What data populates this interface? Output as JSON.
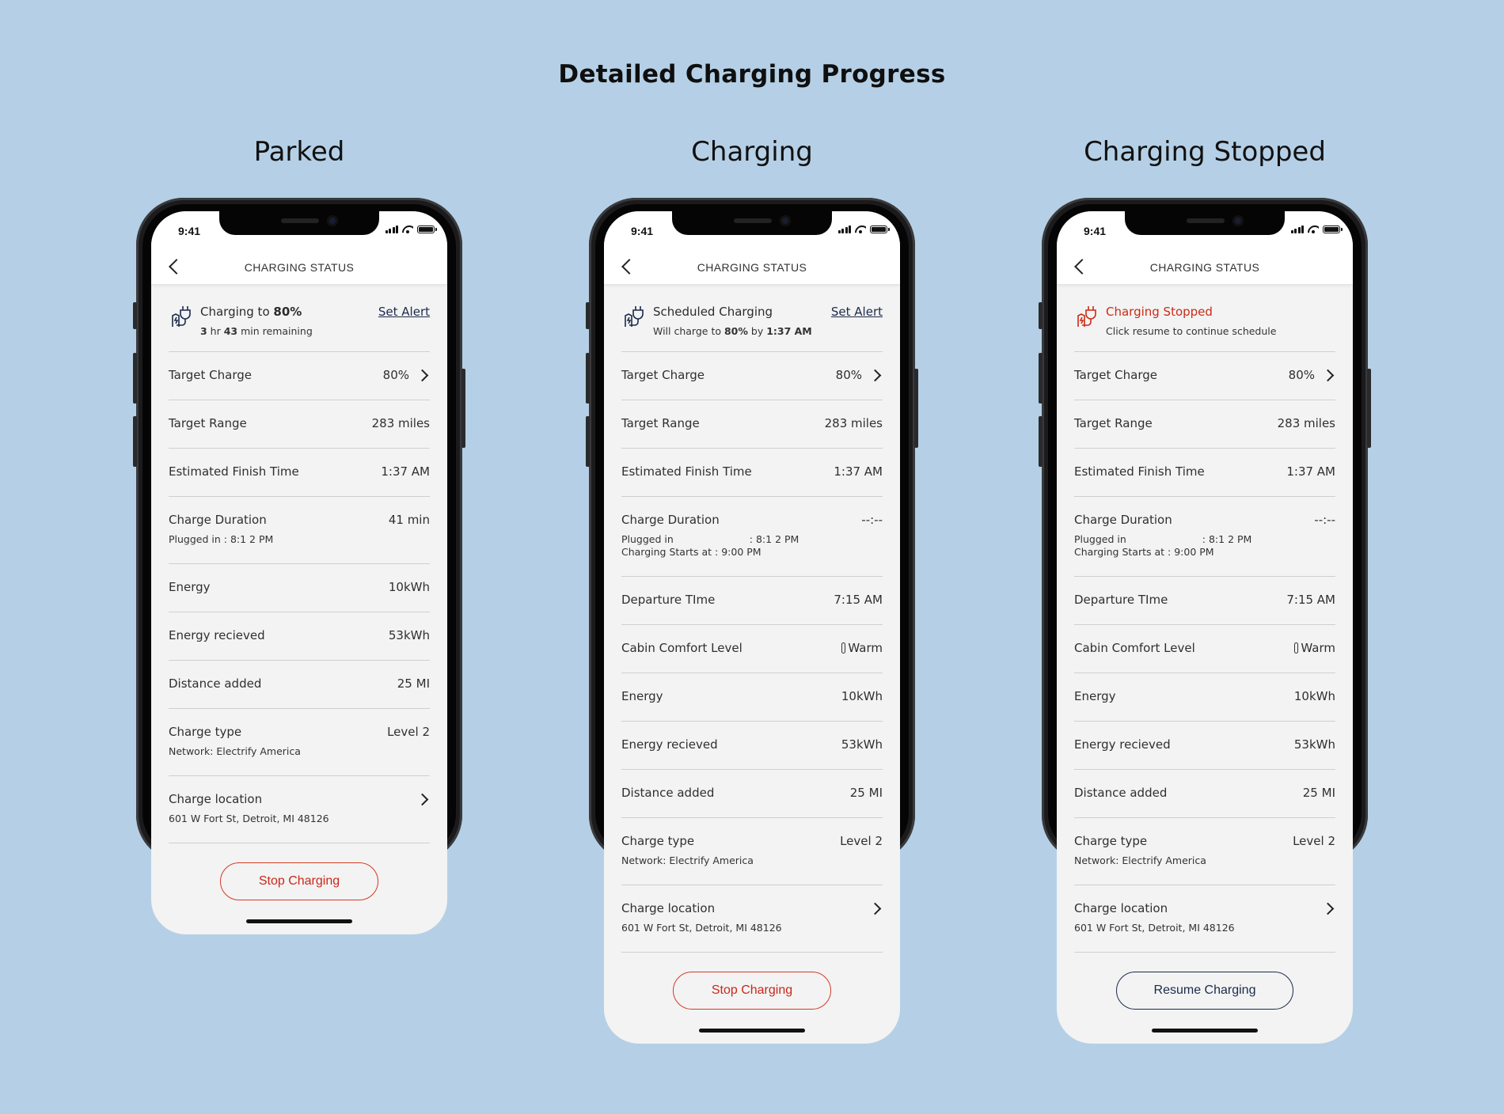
{
  "page_title": "Detailed Charging Progress",
  "colors": {
    "background": "#b5d0e6",
    "alert_red": "#cc2a14",
    "navy": "#1a2b4c"
  },
  "phones": [
    {
      "column_title": "Parked",
      "status_time": "9:41",
      "nav_title": "CHARGING STATUS",
      "header": {
        "icon": "ev-plug-icon",
        "title_prefix": "Charging to ",
        "title_bold": "80%",
        "sub_bold1": "3",
        "sub_mid1": " hr ",
        "sub_bold2": "43",
        "sub_rest": " min remaining",
        "set_alert": "Set Alert"
      },
      "rows": {
        "target_charge": {
          "label": "Target Charge",
          "value": "80%"
        },
        "target_range": {
          "label": "Target Range",
          "value": "283 miles"
        },
        "finish_time": {
          "label": "Estimated Finish Time",
          "value": "1:37 AM"
        },
        "duration": {
          "label": "Charge Duration",
          "value": "41 min",
          "sub": "Plugged in : 8:1 2 PM"
        },
        "energy": {
          "label": "Energy",
          "value": "10kWh"
        },
        "energy_received": {
          "label": "Energy recieved",
          "value": "53kWh"
        },
        "distance": {
          "label": "Distance added",
          "value": "25 MI"
        },
        "charge_type": {
          "label": "Charge type",
          "value": "Level 2",
          "sub": "Network: Electrify America"
        },
        "location": {
          "label": "Charge location",
          "sub": "601 W Fort St, Detroit, MI 48126"
        }
      },
      "button": "Stop Charging"
    },
    {
      "column_title": "Charging",
      "status_time": "9:41",
      "nav_title": "CHARGING STATUS",
      "header": {
        "icon": "ev-plug-icon",
        "title": "Scheduled Charging",
        "sub_prefix": "Will charge to ",
        "sub_bold1": "80%",
        "sub_mid": " by ",
        "sub_bold2": "1:37 AM",
        "set_alert": "Set Alert"
      },
      "rows": {
        "target_charge": {
          "label": "Target Charge",
          "value": "80%"
        },
        "target_range": {
          "label": "Target Range",
          "value": "283 miles"
        },
        "finish_time": {
          "label": "Estimated Finish Time",
          "value": "1:37 AM"
        },
        "duration": {
          "label": "Charge Duration",
          "value": "--:--",
          "sub1_label": "Plugged in",
          "sub1_value": ": 8:1 2 PM",
          "sub2": "Charging Starts at : 9:00 PM"
        },
        "departure": {
          "label": "Departure TIme",
          "value": "7:15 AM"
        },
        "cabin": {
          "label": "Cabin Comfort Level",
          "value": "Warm",
          "icon": "thermometer-icon"
        },
        "energy": {
          "label": "Energy",
          "value": "10kWh"
        },
        "energy_received": {
          "label": "Energy recieved",
          "value": "53kWh"
        },
        "distance": {
          "label": "Distance added",
          "value": "25 MI"
        },
        "charge_type": {
          "label": "Charge type",
          "value": "Level 2",
          "sub": "Network: Electrify America"
        },
        "location": {
          "label": "Charge location",
          "sub": "601 W Fort St, Detroit, MI 48126"
        }
      },
      "button": "Stop Charging"
    },
    {
      "column_title": "Charging Stopped",
      "status_time": "9:41",
      "nav_title": "CHARGING STATUS",
      "header": {
        "icon": "ev-plug-icon",
        "title": "Charging Stopped",
        "sub": "Click resume to continue schedule"
      },
      "rows": {
        "target_charge": {
          "label": "Target Charge",
          "value": "80%"
        },
        "target_range": {
          "label": "Target Range",
          "value": "283 miles"
        },
        "finish_time": {
          "label": "Estimated Finish Time",
          "value": "1:37 AM"
        },
        "duration": {
          "label": "Charge Duration",
          "value": "--:--",
          "sub1_label": "Plugged in",
          "sub1_value": ": 8:1 2 PM",
          "sub2": "Charging Starts at : 9:00 PM"
        },
        "departure": {
          "label": "Departure TIme",
          "value": "7:15 AM"
        },
        "cabin": {
          "label": "Cabin Comfort Level",
          "value": "Warm",
          "icon": "thermometer-icon"
        },
        "energy": {
          "label": "Energy",
          "value": "10kWh"
        },
        "energy_received": {
          "label": "Energy recieved",
          "value": "53kWh"
        },
        "distance": {
          "label": "Distance added",
          "value": "25 MI"
        },
        "charge_type": {
          "label": "Charge type",
          "value": "Level 2",
          "sub": "Network: Electrify America"
        },
        "location": {
          "label": "Charge location",
          "sub": "601 W Fort St, Detroit, MI 48126"
        }
      },
      "button": "Resume Charging"
    }
  ]
}
